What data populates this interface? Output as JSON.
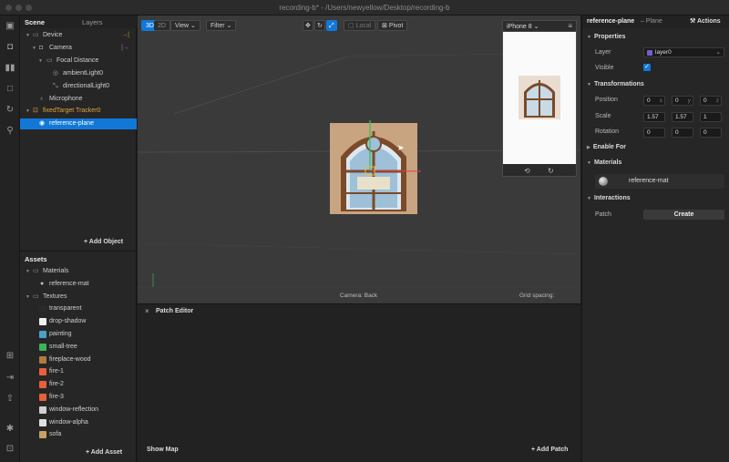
{
  "window": {
    "title": "recording-b* - /Users/newyellow/Desktop/recording-b"
  },
  "scene_panel": {
    "tabs": [
      "Scene",
      "Layers"
    ],
    "tree": [
      {
        "label": "Device",
        "icon": "device-icon",
        "extra": "→|"
      },
      {
        "label": "Camera",
        "icon": "camera-icon",
        "extra": "|→"
      },
      {
        "label": "Focal Distance",
        "icon": "focal-distance-icon",
        "extra": ""
      },
      {
        "label": "ambientLight0",
        "icon": "ambient-light-icon",
        "extra": ""
      },
      {
        "label": "directionalLight0",
        "icon": "directional-light-icon",
        "extra": ""
      },
      {
        "label": "Microphone",
        "icon": "microphone-icon",
        "extra": ""
      },
      {
        "label": "fixedTarget Tracker0",
        "icon": "target-tracker-icon",
        "extra": ""
      },
      {
        "label": "reference-plane",
        "icon": "eye-icon",
        "extra": ""
      }
    ],
    "add_object": "+ Add Object"
  },
  "assets_panel": {
    "title": "Assets",
    "items": [
      {
        "label": "Materials",
        "icon": "folder-icon",
        "color": "#9a9a9a"
      },
      {
        "label": "reference-mat",
        "icon": "material-sphere-icon",
        "color": "#bfbfbf"
      },
      {
        "label": "Textures",
        "icon": "folder-icon",
        "color": "#9a9a9a"
      },
      {
        "label": "transparent",
        "icon": "texture-icon",
        "color": "#2a2a2a"
      },
      {
        "label": "drop-shadow",
        "icon": "texture-icon",
        "color": "#f0f0f0"
      },
      {
        "label": "painting",
        "icon": "texture-icon",
        "color": "#4aa0c8"
      },
      {
        "label": "small-tree",
        "icon": "texture-icon",
        "color": "#3cb45a"
      },
      {
        "label": "fireplace-wood",
        "icon": "texture-icon",
        "color": "#b07a40"
      },
      {
        "label": "fire-1",
        "icon": "texture-icon",
        "color": "#e8603a"
      },
      {
        "label": "fire-2",
        "icon": "texture-icon",
        "color": "#e8603a"
      },
      {
        "label": "fire-3",
        "icon": "texture-icon",
        "color": "#e8603a"
      },
      {
        "label": "window-reflection",
        "icon": "texture-icon",
        "color": "#d0d0d0"
      },
      {
        "label": "window-alpha",
        "icon": "texture-icon",
        "color": "#e0e0e0"
      },
      {
        "label": "sofa",
        "icon": "texture-icon",
        "color": "#c8a060"
      }
    ],
    "add_asset": "+ Add Asset"
  },
  "viewport": {
    "btn_3d": "3D",
    "btn_2d": "2D",
    "view": "View",
    "filter": "Filter",
    "local": "Local",
    "pivot": "Pivot",
    "footer_left": "Camera: Back",
    "footer_right": "Grid spacing:",
    "device": "iPhone 8"
  },
  "patch_editor": {
    "title": "Patch Editor",
    "show_map": "Show Map",
    "add_patch": "+ Add Patch"
  },
  "inspector": {
    "object_name": "reference-plane",
    "object_type": "– Plane",
    "actions": "Actions",
    "properties": "Properties",
    "layer_label": "Layer",
    "layer_value": "layer0",
    "visible_label": "Visible",
    "transformations": "Transformations",
    "position_label": "Position",
    "position": [
      "0",
      "0",
      "0"
    ],
    "scale_label": "Scale",
    "scale": [
      "1.57",
      "1.57",
      "1"
    ],
    "rotation_label": "Rotation",
    "rotation": [
      "0",
      "0",
      "0"
    ],
    "enable_for": "Enable For",
    "materials": "Materials",
    "material_value": "reference-mat",
    "interactions": "Interactions",
    "patch_label": "Patch",
    "create": "Create"
  },
  "colors": {
    "accent": "#1178d8",
    "layer_swatch": "#7a5ad0"
  }
}
